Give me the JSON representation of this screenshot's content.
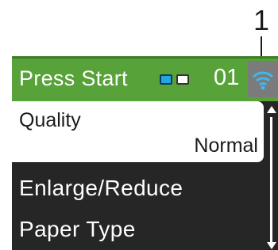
{
  "callout": {
    "number": "1"
  },
  "status_bar": {
    "text": "Press Start",
    "copies": "01",
    "ink_colors": [
      "#1ea7e6",
      "#ffffff"
    ],
    "wifi_icon": "wifi-icon"
  },
  "menu": {
    "selected": {
      "label": "Quality",
      "value": "Normal"
    },
    "items": [
      {
        "label": "Enlarge/Reduce"
      },
      {
        "label": "Paper Type"
      }
    ]
  },
  "colors": {
    "status_bar_bg": "#58a23a",
    "screen_bg": "#262626",
    "wifi_box_bg": "#7b7b7b",
    "wifi_signal": "#3fb8ee"
  }
}
